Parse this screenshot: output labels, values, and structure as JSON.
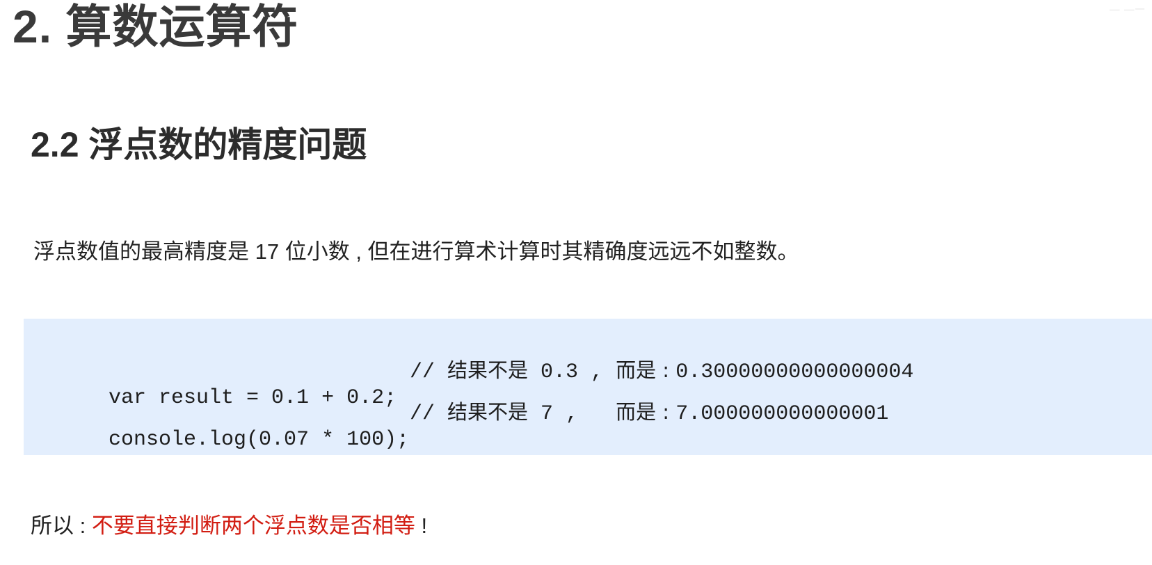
{
  "heading": {
    "title": "2. 算数运算符"
  },
  "section": {
    "title": "2.2 浮点数的精度问题"
  },
  "intro": {
    "text": "浮点数值的最高精度是 17 位小数 , 但在进行算术计算时其精确度远远不如整数。"
  },
  "code": {
    "lines": [
      {
        "code": "var result = 0.1 + 0.2;",
        "comment_prefix": "// ",
        "comment_zh1": "结果不是",
        "comment_v1": " 0.3 , ",
        "comment_zh2": "而是 : ",
        "comment_v2": "0.30000000000000004"
      },
      {
        "code": "console.log(0.07 * 100);",
        "comment_prefix": "// ",
        "comment_zh1": "结果不是",
        "comment_v1": " 7 ,   ",
        "comment_zh2": "而是 : ",
        "comment_v2": "7.000000000000001"
      }
    ]
  },
  "conclusion": {
    "prefix": "所以 : ",
    "warning": "不要直接判断两个浮点数是否相等",
    "suffix": " !",
    "warning_color": "#d21d12"
  },
  "background": {
    "code_box_color": "#e3eefd"
  }
}
